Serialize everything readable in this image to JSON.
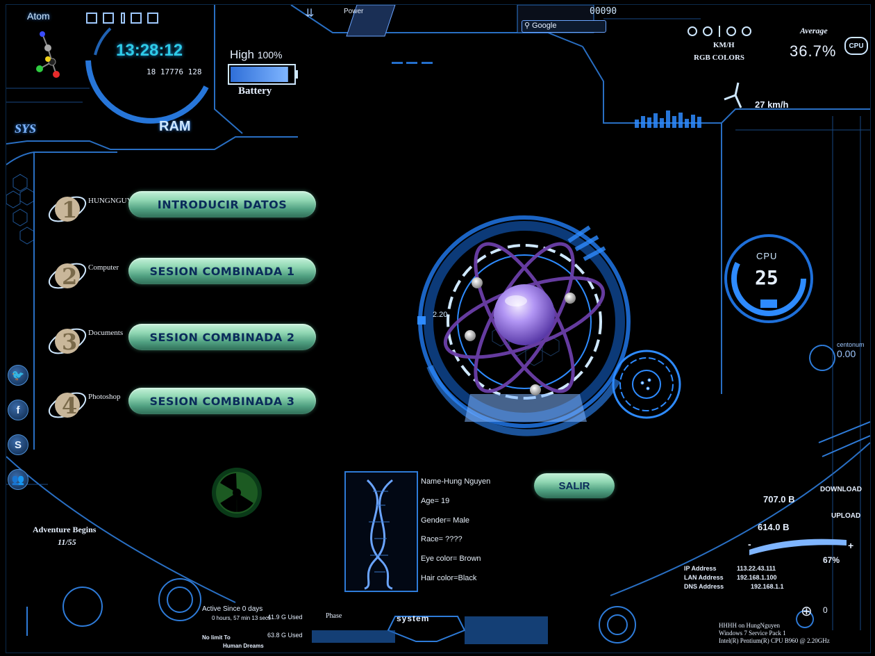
{
  "top": {
    "atom_label": "Atom",
    "power_label": "Power",
    "clock": "13:28:12",
    "date": "18 17776 128",
    "ram_label": "RAM",
    "battery_status": "High",
    "battery_percent": "100%",
    "battery_level": 0.92,
    "battery_label": "Battery",
    "sys_label": "SYS",
    "search_placeholder": "Google",
    "counter": "00090",
    "speed_units": "KM/H",
    "rgb_label": "RGB COLORS",
    "average_label": "Average",
    "cpu_average": "36.7%",
    "cpu_badge": "CPU",
    "speed": "27 km/h"
  },
  "menu": [
    {
      "num": "1",
      "tag": "HUNGNGUYEN",
      "label": "INTRODUCIR DATOS"
    },
    {
      "num": "2",
      "tag": "Computer",
      "label": "SESION COMBINADA 1"
    },
    {
      "num": "3",
      "tag": "Documents",
      "label": "SESION COMBINADA 2"
    },
    {
      "num": "4",
      "tag": "Photoshop",
      "label": "SESION COMBINADA 3"
    }
  ],
  "center": {
    "dial_value": "2.20"
  },
  "cpu_gauge": {
    "label": "CPU",
    "value": "25"
  },
  "right_panel": {
    "header": "centonum",
    "sub": "0.00"
  },
  "profile": {
    "name": "Name-Hung Nguyen",
    "age": "Age= 19",
    "gender": "Gender= Male",
    "race": "Race= ????",
    "eye": "Eye color= Brown",
    "hair": "Hair color=Black"
  },
  "exit_button": "SALIR",
  "network": {
    "download_value": "707.0 B",
    "download_label": "DOWNLOAD",
    "upload_value": "614.0 B",
    "upload_label": "UPLOAD",
    "volume_minus": "-",
    "volume_plus": "+",
    "volume": "67%",
    "ip_label": "IP Address",
    "ip_value": "113.22.43.111",
    "lan_label": "LAN Address",
    "lan_value": "192.168.1.100",
    "dns_label": "DNS Address",
    "dns_value": "192.168.1.1"
  },
  "bottom": {
    "adventure": "Adventure Begins",
    "adventure_date": "11/55",
    "active_since": "Active Since 0 days",
    "uptime": "0 hours, 57 min 13 secs",
    "disk1": "41.9 G Used",
    "disk2": "63.8 G Used",
    "no_limit": "No limit To",
    "human_dreams": "Human Dreams",
    "phase_label": "Phase",
    "system_label": "system",
    "host": "HHHH on HungNguyen",
    "os": "Windows 7 Service Pack 1",
    "cpu_model": "Intel(R) Pentium(R) CPU B960 @ 2.20GHz",
    "target_value": "0"
  },
  "colors": {
    "accent": "#2e8bff",
    "button_green": "#8fd6b2",
    "button_text": "#0a2b5a",
    "atom_purple": "#9b7ef0"
  },
  "icons": {
    "social": [
      "twitter-bird-icon",
      "facebook-icon",
      "skype-icon",
      "people-icon"
    ]
  },
  "social_glyphs": [
    "🐦",
    "f",
    "S",
    "👥"
  ]
}
